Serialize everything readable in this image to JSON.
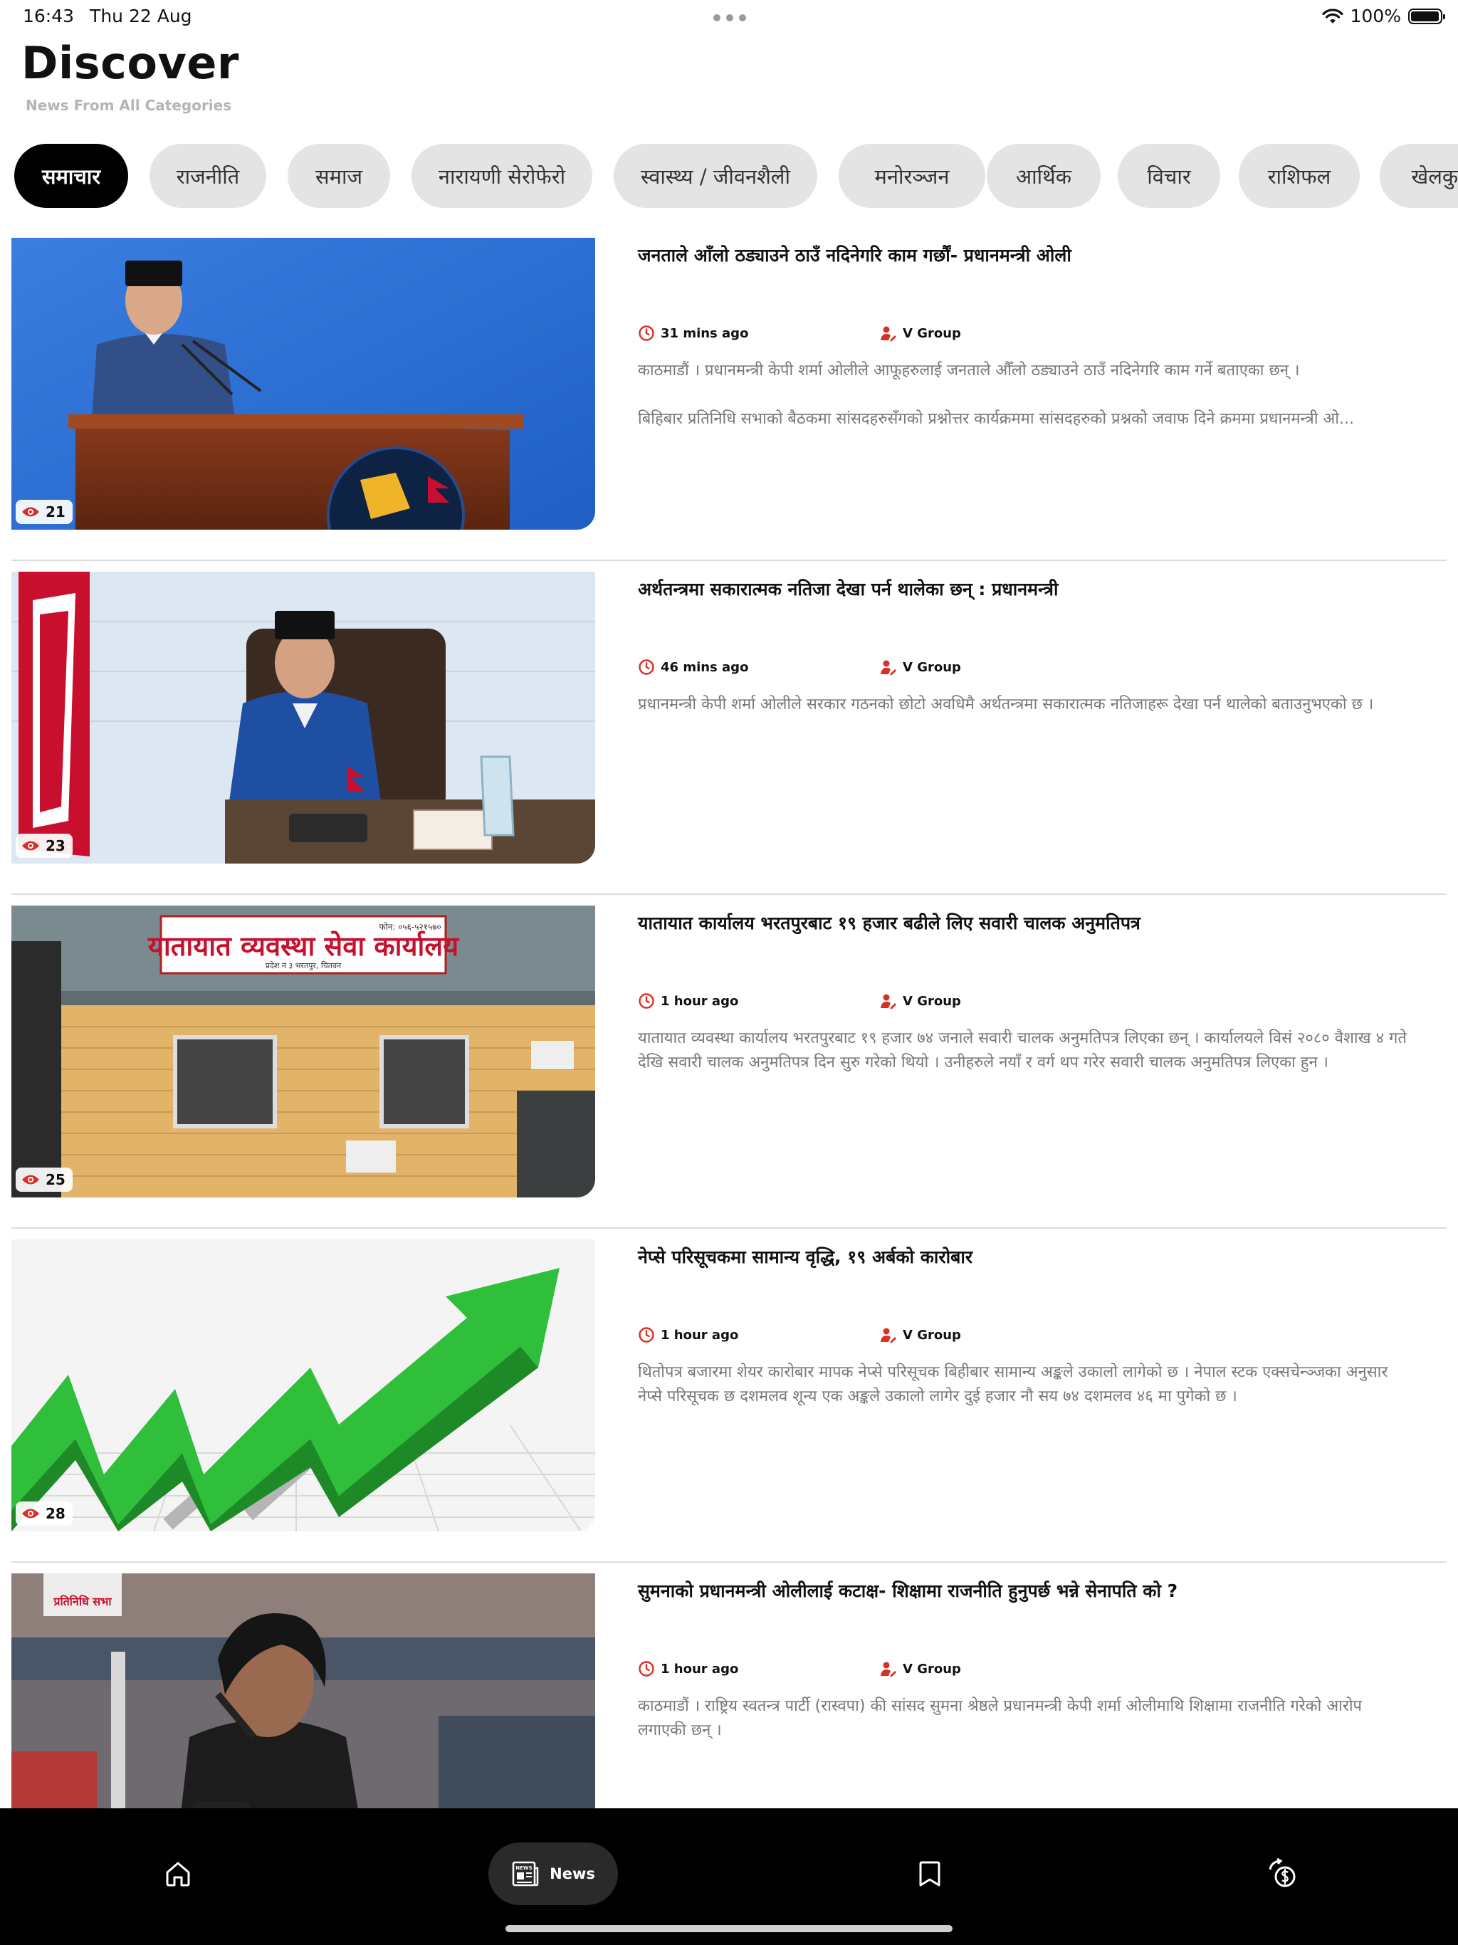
{
  "status_bar": {
    "time": "16:43",
    "date": "Thu 22 Aug",
    "battery": "100%"
  },
  "header": {
    "title": "Discover",
    "subtitle": "News From All Categories"
  },
  "categories": [
    {
      "label": "समाचार",
      "active": true
    },
    {
      "label": "राजनीति"
    },
    {
      "label": "समाज"
    },
    {
      "label": "नारायणी सेरोफेरो"
    },
    {
      "label": "स्वास्थ्य / जीवनशैली"
    },
    {
      "label": "मनोरञ्जन"
    },
    {
      "label": "आर्थिक"
    },
    {
      "label": "विचार"
    },
    {
      "label": "राशिफल"
    },
    {
      "label": "खेलकुद"
    }
  ],
  "articles": [
    {
      "headline": "जनताले आँलो ठड्याउने ठाउँ नदिनेगरि काम गर्छौं- प्रधानमन्त्री ओली",
      "time": "31 mins ago",
      "author": "V Group",
      "views": "21",
      "excerpt": "काठमाडौं । प्रधानमन्त्री केपी शर्मा ओलीले आफूहरुलाई जनताले औँलो ठड्याउने ठाउँ नदिनेगरि काम गर्ने बताएका छन् ।\n\nबिहिबार प्रतिनिधि सभाको बैठकमा सांसदहरुसँगको प्रश्नोत्तर कार्यक्रममा सांसदहरुको प्रश्नको जवाफ दिने क्रममा प्रधानमन्त्री ओ..."
    },
    {
      "headline": "अर्थतन्त्रमा सकारात्मक नतिजा देखा पर्न थालेका छन् : प्रधानमन्त्री",
      "time": "46 mins ago",
      "author": "V Group",
      "views": "23",
      "excerpt": "प्रधानमन्त्री केपी शर्मा ओलीले सरकार गठनको छोटो अवधिमै अर्थतन्त्रमा सकारात्मक नतिजाहरू देखा पर्न थालेको बताउनुभएको छ ।"
    },
    {
      "headline": "यातायात कार्यालय भरतपुरबाट १९ हजार बढीले लिए सवारी चालक अनुमतिपत्र",
      "time": "1 hour ago",
      "author": "V Group",
      "views": "25",
      "excerpt": "यातायात व्यवस्था कार्यालय भरतपुरबाट १९ हजार ७४ जनाले सवारी चालक अनुमतिपत्र लिएका छन् । कार्यालयले विसं २०८० वैशाख ४ गते देखि सवारी चालक अनुमतिपत्र दिन सुरु गरेको थियो । उनीहरुले नयाँ र वर्ग थप गरेर सवारी चालक अनुमतिपत्र लिएका हुन ।",
      "sign_title": "यातायात व्यवस्था सेवा कार्यालय",
      "sign_small": "फोन: ०५६-५२१५७०",
      "sign_sub": "प्रदेश नं ३ भरतपुर, चितवन"
    },
    {
      "headline": "नेप्से परिसूचकमा सामान्य वृद्धि, १९ अर्बको कारोबार",
      "time": "1 hour ago",
      "author": "V Group",
      "views": "28",
      "excerpt": "थितोपत्र बजारमा शेयर कारोबार मापक नेप्से परिसूचक बिहीबार सामान्य अङ्कले उकालो लागेको छ । नेपाल स्टक एक्सचेन्ञ्जका अनुसार नेप्से परिसूचक छ दशमलव शून्य एक अङ्कले उकालो लागेर दुई हजार नौ सय ७४ दशमलव ४६ मा पुगेको छ ।"
    },
    {
      "headline": "सुमनाको प्रधानमन्त्री ओलीलाई कटाक्ष- शिक्षामा राजनीति हुनुपर्छ भन्ने सेनापति को ?",
      "time": "1 hour ago",
      "author": "V Group",
      "views": "",
      "excerpt": "काठमाडौं । राष्ट्रिय स्वतन्त्र पार्टी (रास्वपा) की सांसद सुमना श्रेष्ठले प्रधानमन्त्री केपी शर्मा ओलीमाथि शिक्षामा राजनीति गरेको आरोप लगाएकी छन् ।",
      "logo_text": "प्रतिनिधि सभा"
    }
  ],
  "tab_bar": {
    "news_label": "News",
    "news_icon_text": "NEWS"
  },
  "colors": {
    "accent": "#d93025",
    "active_pill": "#000000",
    "pill": "#e4e4e4",
    "tab_bar": "#000000"
  },
  "icons": [
    "wifi-icon",
    "battery-icon",
    "eye-icon",
    "clock-icon",
    "author-icon",
    "home-icon",
    "newspaper-icon",
    "bookmark-icon",
    "currency-exchange-icon"
  ]
}
